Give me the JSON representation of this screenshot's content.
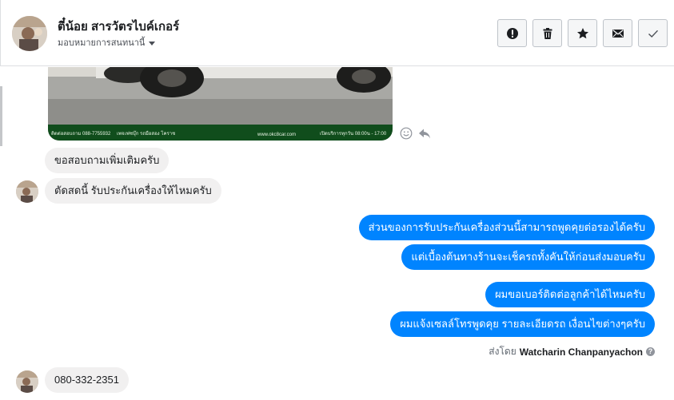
{
  "header": {
    "contact_name": "ตี๋น้อย สารวัตรไบค์เกอร์",
    "assign_label": "มอบหมายการสนทนานี้",
    "actions": [
      {
        "name": "mark-spam-button",
        "icon": "alert-circle-icon"
      },
      {
        "name": "delete-button",
        "icon": "trash-icon"
      },
      {
        "name": "star-button",
        "icon": "star-icon"
      },
      {
        "name": "mark-unread-button",
        "icon": "envelope-icon"
      },
      {
        "name": "mark-done-button",
        "icon": "check-icon"
      }
    ]
  },
  "photo_band": {
    "left_text": "ติดต่อสอบถาม 088-7755932",
    "mid_text": "เพจเฟซบุ๊ก รถมือสอง โคราช",
    "site_text": "www.okc8car.com",
    "right_text": "เปิดบริการทุกวัน 08:00น - 17:00"
  },
  "messages": {
    "incoming_1": "ขอสอบถามเพิ่มเติมครับ",
    "incoming_2": "ตัดสดนี้ รับประกันเครื่องให้ไหมครับ",
    "outgoing_1": "ส่วนของการรับประกันเครื่องส่วนนี้สามารถพูดคุยต่อรองได้ครับ",
    "outgoing_2": "แต่เบื้องต้นทางร้านจะเช็ครถทั้งคันให้ก่อนส่งมอบครับ",
    "outgoing_3": "ผมขอเบอร์ติดต่อลูกค้าได้ไหมครับ",
    "outgoing_4": "ผมแจ้งเซลล์โทรพูดคุย รายละเอียดรถ เงื่อนไขต่างๆครับ",
    "incoming_3": "080-332-2351"
  },
  "sent_by": {
    "prefix": "ส่งโดย",
    "agent": "Watcharin Chanpanyachon",
    "help": "?"
  },
  "colors": {
    "outgoing_bubble": "#0084ff",
    "incoming_bubble": "#f1f0f0"
  }
}
